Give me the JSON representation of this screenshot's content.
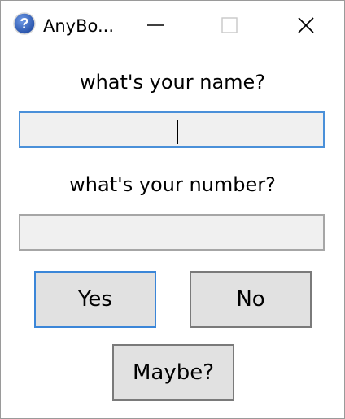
{
  "window": {
    "title": "AnyBo...",
    "icon": "help-question-icon",
    "controls": {
      "minimize": "minimize-icon",
      "maximize": "maximize-icon",
      "close": "close-icon"
    }
  },
  "form": {
    "name_label": "what's your name?",
    "name_value": "",
    "number_label": "what's your number?",
    "number_value": ""
  },
  "buttons": {
    "yes": "Yes",
    "no": "No",
    "maybe": "Maybe?"
  },
  "colors": {
    "focus_border": "#4a90d9",
    "field_bg": "#f0f0f0",
    "button_bg": "#e1e1e1",
    "icon_blue": "#2f5fb3"
  }
}
